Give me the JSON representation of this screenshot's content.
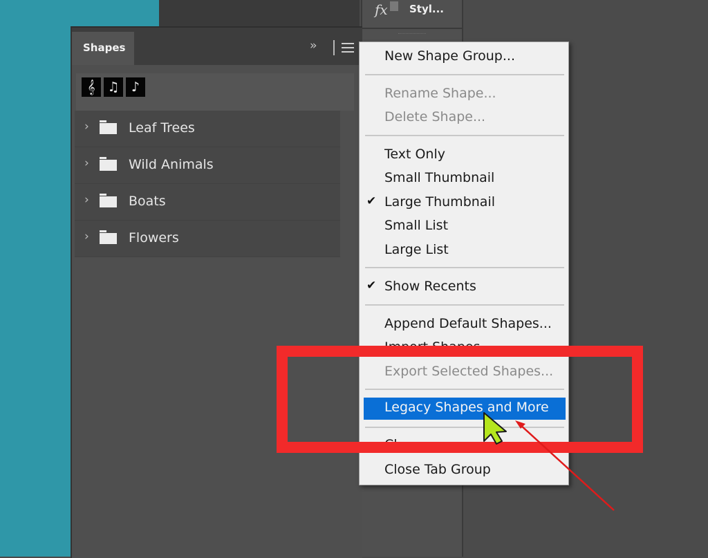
{
  "styles_panel": {
    "icon": "fx-icon",
    "label": "Styl..."
  },
  "shapes_panel": {
    "tab_label": "Shapes",
    "collapse_icon": "double-chevron-right-icon",
    "collapse_glyph": "››",
    "menu_icon": "hamburger-menu-icon",
    "recent_shapes": [
      {
        "name": "treble-clef",
        "glyph": "𝄞"
      },
      {
        "name": "beamed-notes",
        "glyph": "♫"
      },
      {
        "name": "eighth-note",
        "glyph": "♪"
      }
    ],
    "groups": [
      {
        "label": "Leaf Trees"
      },
      {
        "label": "Wild Animals"
      },
      {
        "label": "Boats"
      },
      {
        "label": "Flowers"
      }
    ],
    "chevron_glyph": "›"
  },
  "context_menu": {
    "items": [
      {
        "label": "New Shape Group...",
        "enabled": true
      },
      {
        "label": "Rename Shape...",
        "enabled": false
      },
      {
        "label": "Delete Shape...",
        "enabled": false
      },
      {
        "label": "Text Only",
        "enabled": true
      },
      {
        "label": "Small Thumbnail",
        "enabled": true
      },
      {
        "label": "Large Thumbnail",
        "enabled": true,
        "checked": true
      },
      {
        "label": "Small List",
        "enabled": true
      },
      {
        "label": "Large List",
        "enabled": true
      },
      {
        "label": "Show Recents",
        "enabled": true,
        "checked": true
      },
      {
        "label": "Append Default Shapes...",
        "enabled": true
      },
      {
        "label": "Import Shapes...",
        "enabled": true,
        "partially_obscured": true
      },
      {
        "label": "Export Selected Shapes...",
        "enabled": false
      },
      {
        "label": "Legacy Shapes and More",
        "enabled": true,
        "highlighted": true
      },
      {
        "label": "Cl",
        "enabled": true,
        "partially_obscured": true
      },
      {
        "label": "Close Tab Group",
        "enabled": true
      }
    ],
    "check_glyph": "✔"
  },
  "annotations": {
    "highlight_box_color": "#f22a2a",
    "arrow_color": "#e01b1b",
    "cursor_color": "#b5e61d",
    "highlight_color": "#0a6fd6"
  }
}
